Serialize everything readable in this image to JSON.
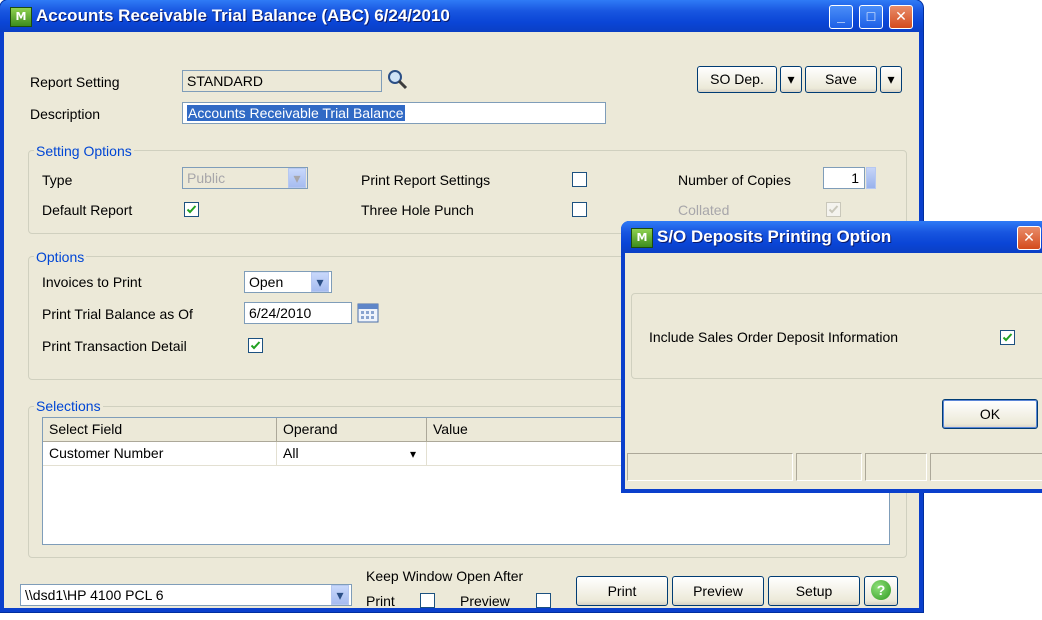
{
  "main_window": {
    "title": "Accounts Receivable Trial Balance (ABC) 6/24/2010",
    "app_icon_text": "M",
    "minimize_glyph": "_",
    "maximize_glyph": "□",
    "close_glyph": "✕"
  },
  "report": {
    "setting_label": "Report Setting",
    "setting_value": "STANDARD",
    "description_label": "Description",
    "description_value": "Accounts Receivable Trial Balance",
    "so_dep_button": "SO Dep.",
    "save_button": "Save"
  },
  "setting_options": {
    "title": "Setting Options",
    "type_label": "Type",
    "type_value": "Public",
    "default_report_label": "Default Report",
    "default_report_checked": true,
    "print_report_settings_label": "Print Report Settings",
    "print_report_settings_checked": false,
    "three_hole_punch_label": "Three Hole Punch",
    "three_hole_punch_checked": false,
    "copies_label": "Number of Copies",
    "copies_value": "1",
    "collated_label": "Collated",
    "collated_checked": true
  },
  "options": {
    "title": "Options",
    "invoices_label": "Invoices to Print",
    "invoices_value": "Open",
    "as_of_label": "Print Trial Balance as Of",
    "as_of_value": "6/24/2010",
    "detail_label": "Print Transaction Detail",
    "detail_checked": true
  },
  "selections": {
    "title": "Selections",
    "columns": [
      "Select Field",
      "Operand",
      "Value"
    ],
    "rows": [
      {
        "field": "Customer Number",
        "operand": "All",
        "value": ""
      }
    ]
  },
  "footer": {
    "printer": "\\\\dsd1\\HP 4100 PCL 6",
    "keep_open_label": "Keep Window Open After",
    "print_label": "Print",
    "preview_label": "Preview",
    "print_checked": false,
    "preview_checked": false,
    "print_button": "Print",
    "preview_button": "Preview",
    "setup_button": "Setup",
    "help_glyph": "?"
  },
  "dialog": {
    "title": "S/O Deposits Printing Option",
    "app_icon_text": "M",
    "include_label": "Include Sales Order Deposit Information",
    "include_checked": true,
    "ok_button": "OK",
    "close_glyph": "✕"
  },
  "colors": {
    "title_blue": "#0a45d6",
    "group_title": "#0046d5",
    "window_bg": "#ece9d8",
    "check_green": "#21a121"
  }
}
